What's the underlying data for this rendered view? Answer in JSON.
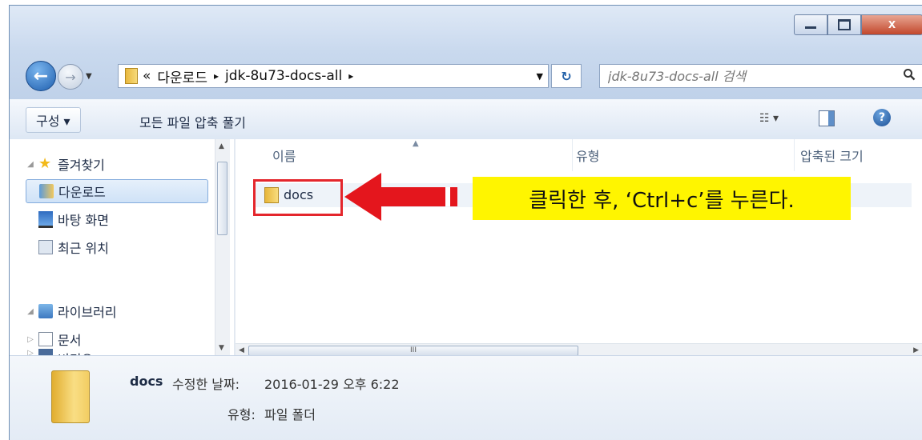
{
  "window": {
    "controls": {
      "minimize": "",
      "maximize": "",
      "close": "X"
    }
  },
  "nav": {
    "back_glyph": "←",
    "forward_glyph": "→",
    "history_glyph": "▼",
    "breadcrumb_prefix": "«",
    "breadcrumb": [
      "다운로드",
      "jdk-8u73-docs-all"
    ],
    "breadcrumb_sep": "▸",
    "dropdown_glyph": "▼",
    "refresh_glyph": "↻",
    "search_placeholder": "jdk-8u73-docs-all 검색",
    "search_icon": "search-icon"
  },
  "toolbar": {
    "organize": "구성 ▾",
    "extract_all": "모든 파일 압축 풀기",
    "view_menu": "☷ ▾",
    "help": "?"
  },
  "sidebar": {
    "favorites": "즐겨찾기",
    "items": [
      {
        "label": "다운로드",
        "icon": "downloads-icon",
        "selected": true
      },
      {
        "label": "바탕 화면",
        "icon": "desktop-icon",
        "selected": false
      },
      {
        "label": "최근 위치",
        "icon": "recent-places-icon",
        "selected": false
      }
    ],
    "libraries": "라이브러리",
    "library_items": [
      {
        "label": "문서",
        "icon": "documents-icon"
      },
      {
        "label": "비디오",
        "icon": "videos-icon"
      }
    ]
  },
  "columns": {
    "name": "이름",
    "type": "유형",
    "compressed_size": "압축된 크기"
  },
  "files": [
    {
      "name": "docs"
    }
  ],
  "annotation": {
    "callout": "클릭한 후, ‘Ctrl+c’를 누른다."
  },
  "scroll": {
    "grip": "III"
  },
  "details": {
    "name": "docs",
    "modified_label": "수정한 날짜:",
    "modified_value": "2016-01-29 오후 6:22",
    "type_label": "유형:",
    "type_value": "파일 폴더"
  },
  "colors": {
    "highlight_border": "#e4262c",
    "arrow": "#e4161d",
    "callout_bg": "#fff500"
  }
}
